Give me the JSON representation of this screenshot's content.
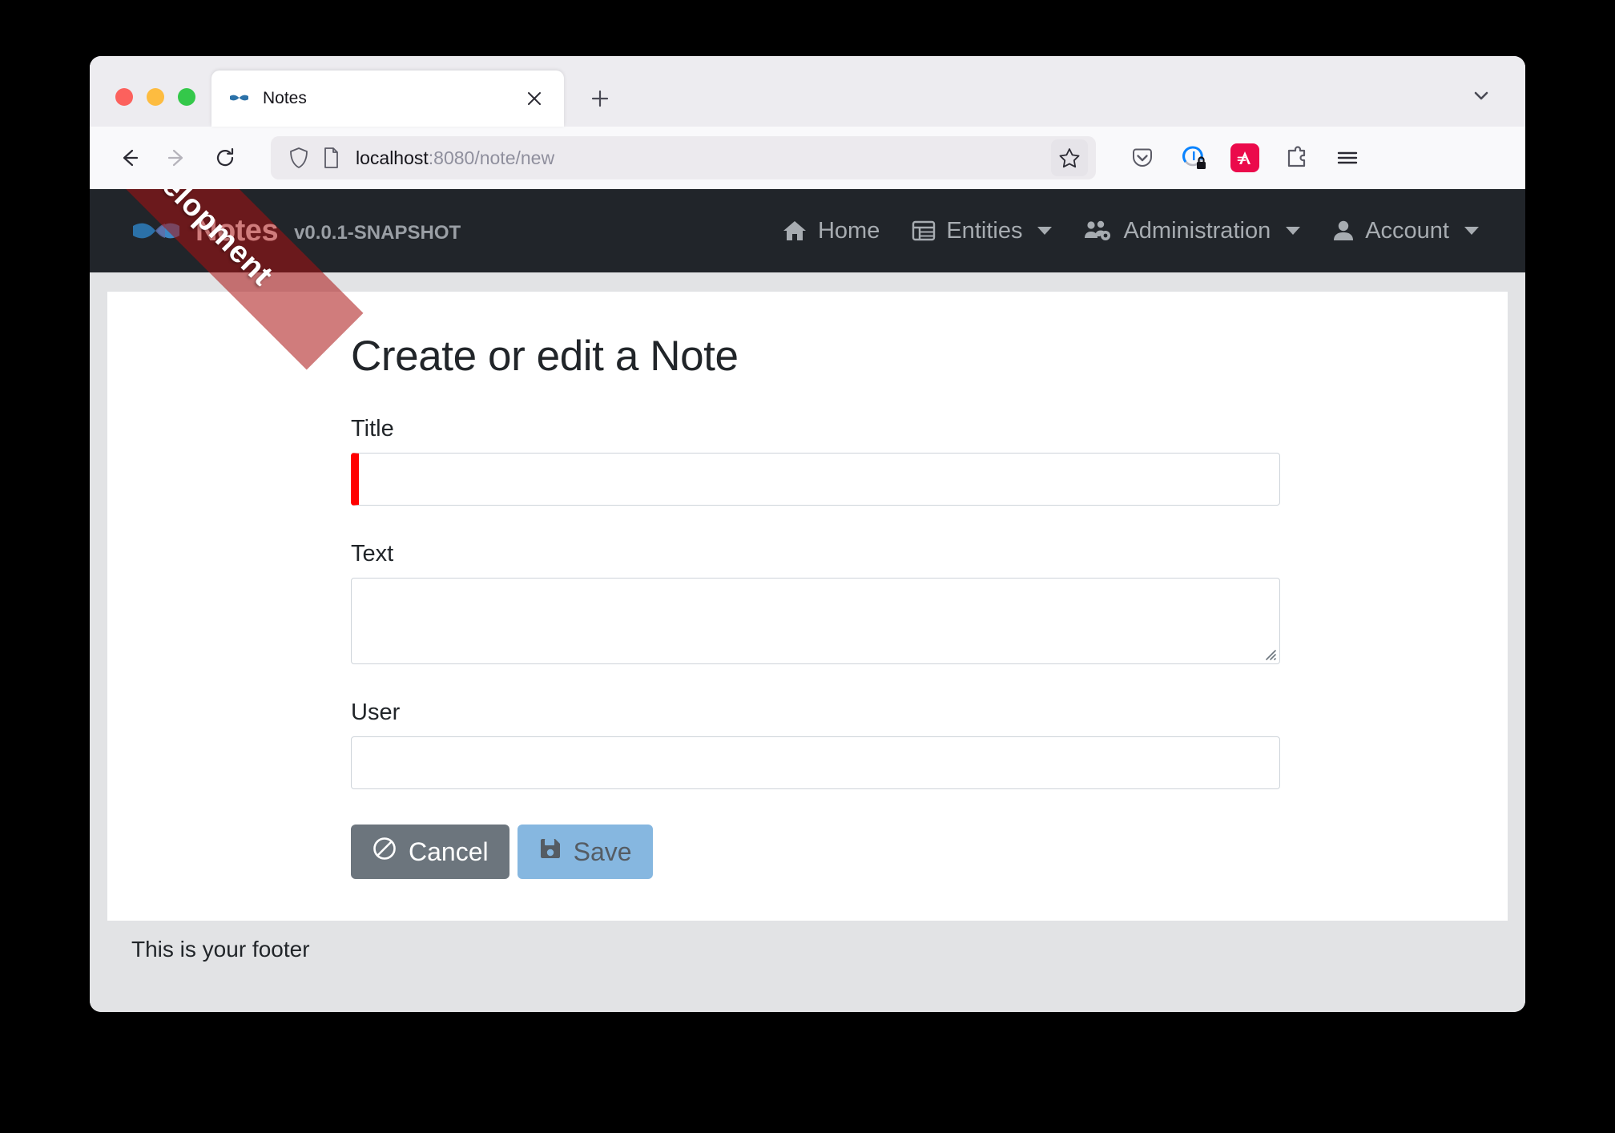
{
  "browser": {
    "tab": {
      "title": "Notes",
      "favicon_icon": "bowtie-favicon",
      "close_icon": "close-icon"
    },
    "new_tab_icon": "plus-icon",
    "tab_list_icon": "chevron-down-icon",
    "back_icon": "back-arrow-icon",
    "forward_icon": "forward-arrow-icon",
    "reload_icon": "reload-icon",
    "url": {
      "host": "localhost",
      "rest": ":8080/note/new"
    },
    "shield_icon": "shield-icon",
    "page_icon": "page-document-icon",
    "bookmark_icon": "star-icon",
    "actions": [
      {
        "name": "pocket-icon",
        "label": "Pocket"
      },
      {
        "name": "container-lock-icon",
        "label": "Container"
      },
      {
        "name": "extension-a-icon",
        "label": "A"
      },
      {
        "name": "puzzle-icon",
        "label": "Extensions"
      },
      {
        "name": "hamburger-menu-icon",
        "label": "Menu"
      }
    ]
  },
  "app": {
    "ribbon": "Development",
    "brand": {
      "name": "Notes",
      "version": "v0.0.1-SNAPSHOT",
      "logo_icon": "bowtie-logo-icon"
    },
    "nav": [
      {
        "label": "Home",
        "icon": "home-icon",
        "has_caret": false
      },
      {
        "label": "Entities",
        "icon": "table-list-icon",
        "has_caret": true
      },
      {
        "label": "Administration",
        "icon": "users-cog-icon",
        "has_caret": true
      },
      {
        "label": "Account",
        "icon": "user-icon",
        "has_caret": true
      }
    ],
    "footer": "This is your footer"
  },
  "form": {
    "title": "Create or edit a Note",
    "fields": [
      {
        "label": "Title",
        "value": "",
        "placeholder": "",
        "required": true
      },
      {
        "label": "Text",
        "value": "",
        "placeholder": "",
        "required": false
      },
      {
        "label": "User",
        "value": "",
        "placeholder": "",
        "required": false
      }
    ],
    "cancel_label": "Cancel",
    "cancel_icon": "ban-icon",
    "save_label": "Save",
    "save_icon": "floppy-save-icon"
  },
  "colors": {
    "navbar_bg": "#21252a",
    "page_bg": "#e2e3e5",
    "required_marker": "#ff0000",
    "save_disabled": "#86b7e0",
    "cancel_bg": "#6c757d",
    "brand_blue": "#2b71a8"
  }
}
